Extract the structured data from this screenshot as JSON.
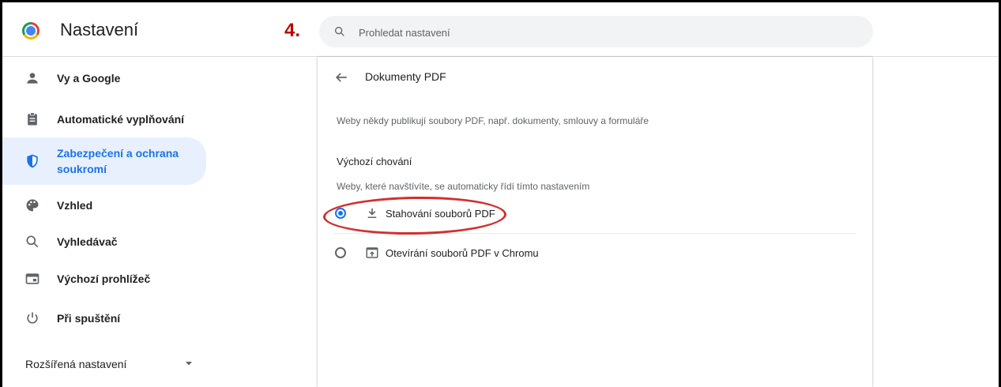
{
  "header": {
    "title": "Nastavení",
    "step": "4."
  },
  "search": {
    "placeholder": "Prohledat nastavení"
  },
  "sidebar": {
    "items": [
      {
        "label": "Vy a Google",
        "icon": "person-icon"
      },
      {
        "label": "Automatické vyplňování",
        "icon": "clipboard-icon"
      },
      {
        "label": "Zabezpečení a ochrana soukromí",
        "icon": "shield-icon",
        "active": true
      },
      {
        "label": "Vzhled",
        "icon": "palette-icon"
      },
      {
        "label": "Vyhledávač",
        "icon": "search-icon"
      },
      {
        "label": "Výchozí prohlížeč",
        "icon": "browser-icon"
      },
      {
        "label": "Při spuštění",
        "icon": "power-icon"
      }
    ],
    "advanced": "Rozšířená nastavení"
  },
  "main": {
    "title": "Dokumenty PDF",
    "description": "Weby někdy publikují soubory PDF, např. dokumenty, smlouvy a formuláře",
    "section_title": "Výchozí chování",
    "section_subtitle": "Weby, které navštívíte, se automaticky řídí tímto nastavením",
    "options": [
      {
        "label": "Stahování souborů PDF",
        "icon": "download-icon",
        "selected": true
      },
      {
        "label": "Otevírání souborů PDF v Chromu",
        "icon": "open-in-browser-icon",
        "selected": false
      }
    ]
  },
  "colors": {
    "accent": "#1a73e8",
    "active_bg": "#e8f0fe",
    "highlight": "#d32f2f",
    "step_label": "#c00000"
  }
}
